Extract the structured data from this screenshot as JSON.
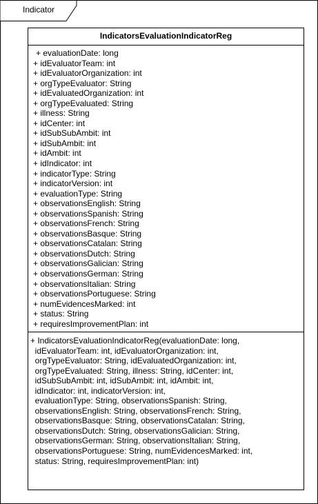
{
  "package": {
    "label": "Indicator"
  },
  "class": {
    "name": "IndicatorsEvaluationIndicatorReg",
    "attributes": [
      "+ evaluationDate: long",
      "+ idEvaluatorTeam: int",
      "+ idEvaluatorOrganization: int",
      "+ orgTypeEvaluator: String",
      "+ idEvaluatedOrganization: int",
      "+ orgTypeEvaluated: String",
      "+ illness: String",
      "+ idCenter: int",
      "+ idSubSubAmbit: int",
      "+ idSubAmbit: int",
      "+ idAmbit: int",
      "+ idIndicator: int",
      "+ indicatorType: String",
      "+ indicatorVersion: int",
      "+ evaluationType: String",
      "+ observationsEnglish: String",
      "+ observationsSpanish: String",
      "+ observationsFrench: String",
      "+ observationsBasque: String",
      "+ observationsCatalan: String",
      "+ observationsDutch: String",
      "+ observationsGalician: String",
      "+ observationsGerman: String",
      "+ observationsItalian: String",
      "+ observationsPortuguese: String",
      "+ numEvidencesMarked: int",
      "+ status: String",
      "+ requiresImprovementPlan: int"
    ],
    "operations": [
      "+ IndicatorsEvaluationIndicatorReg(evaluationDate: long,",
      "  idEvaluatorTeam: int, idEvaluatorOrganization: int,",
      "  orgTypeEvaluator: String, idEvaluatedOrganization: int,",
      "  orgTypeEvaluated: String, illness: String, idCenter: int,",
      "  idSubSubAmbit: int, idSubAmbit: int, idAmbit: int,",
      "  idIndicator: int, indicatorVersion: int,",
      "  evaluationType: String, observationsSpanish: String,",
      "  observationsEnglish: String, observationsFrench: String,",
      "  observationsBasque: String, observationsCatalan: String,",
      "  observationsDutch: String, observationsGalician: String,",
      "  observationsGerman: String, observationsItalian: String,",
      "  observationsPortuguese: String, numEvidencesMarked: int,",
      "  status: String, requiresImprovementPlan: int)"
    ]
  }
}
